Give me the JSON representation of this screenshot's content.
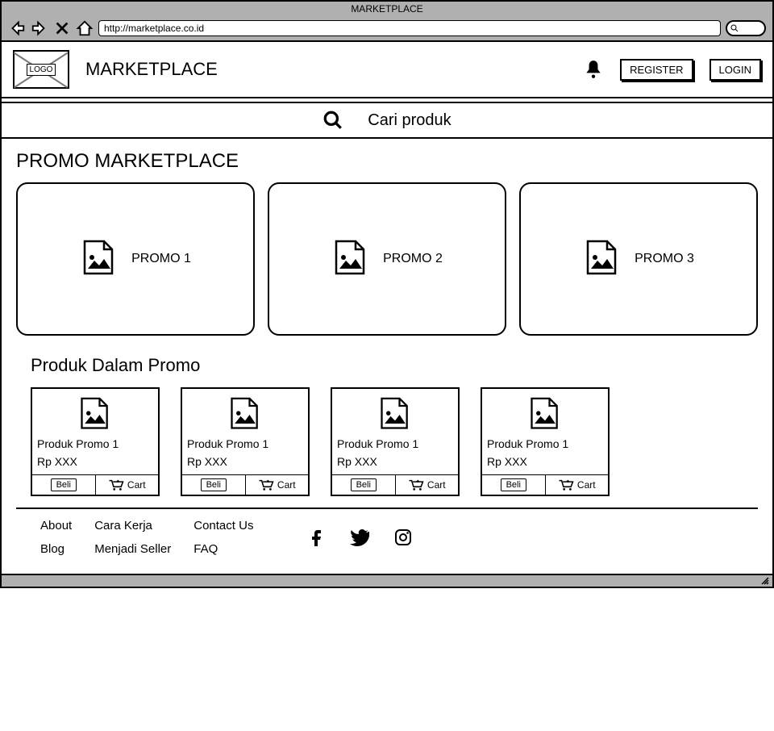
{
  "browser": {
    "title": "MARKETPLACE",
    "url": "http://marketplace.co.id"
  },
  "header": {
    "logo_text": "LOGO",
    "brand": "MARKETPLACE",
    "register_label": "REGISTER",
    "login_label": "LOGIN"
  },
  "search": {
    "placeholder": "Cari produk"
  },
  "promo_section": {
    "title": "PROMO MARKETPLACE",
    "cards": [
      {
        "label": "PROMO 1"
      },
      {
        "label": "PROMO 2"
      },
      {
        "label": "PROMO 3"
      }
    ]
  },
  "products_section": {
    "title": "Produk Dalam Promo",
    "items": [
      {
        "name": "Produk Promo 1",
        "price": "Rp XXX",
        "buy_label": "Beli",
        "cart_label": "Cart"
      },
      {
        "name": "Produk Promo 1",
        "price": "Rp XXX",
        "buy_label": "Beli",
        "cart_label": "Cart"
      },
      {
        "name": "Produk Promo 1",
        "price": "Rp XXX",
        "buy_label": "Beli",
        "cart_label": "Cart"
      },
      {
        "name": "Produk Promo 1",
        "price": "Rp XXX",
        "buy_label": "Beli",
        "cart_label": "Cart"
      }
    ]
  },
  "footer": {
    "links": {
      "about": "About",
      "cara_kerja": "Cara Kerja",
      "contact_us": "Contact Us",
      "blog": "Blog",
      "menjadi_seller": "Menjadi Seller",
      "faq": "FAQ"
    }
  }
}
